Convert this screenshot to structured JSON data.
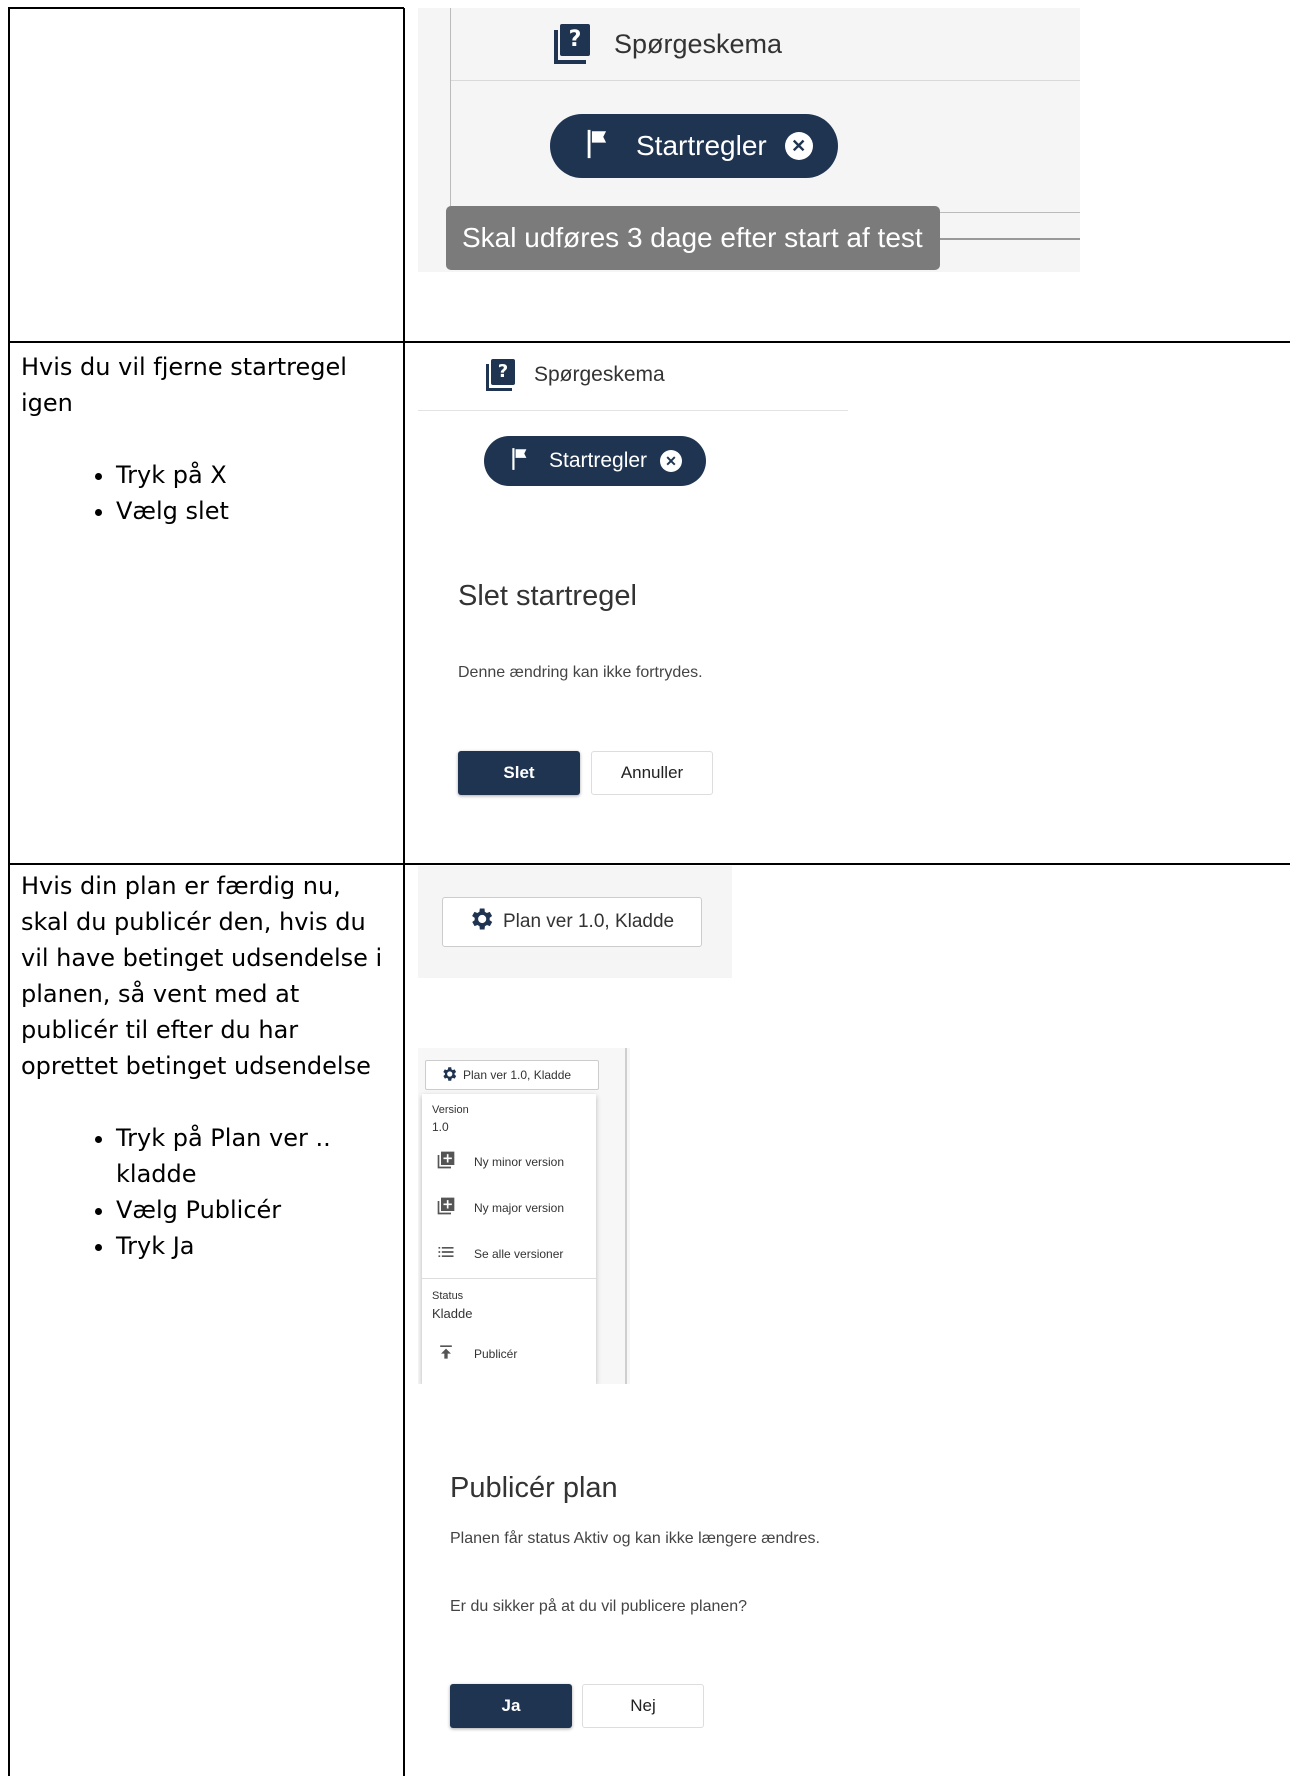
{
  "colors": {
    "navy": "#1f3451",
    "tooltip": "#7b7b7b"
  },
  "row1": {
    "left_text": "",
    "questionnaire_label": "Spørgeskema",
    "chip_label": "Startregler",
    "tooltip": "Skal udføres 3 dage efter start af test"
  },
  "row2": {
    "intro": "Hvis du vil fjerne startregel igen",
    "bullets": [
      "Tryk på X",
      "Vælg slet"
    ],
    "questionnaire_label": "Spørgeskema",
    "chip_label": "Startregler",
    "dialog_title": "Slet startregel",
    "dialog_text": "Denne ændring kan ikke fortrydes.",
    "confirm_label": "Slet",
    "cancel_label": "Annuller"
  },
  "row3": {
    "intro": "Hvis din plan er færdig nu, skal du publicér den, hvis du vil have betinget udsendelse i planen, så vent med at publicér til efter du har oprettet betinget udsendelse",
    "bullets": [
      "Tryk på Plan ver .. kladde",
      "Vælg Publicér",
      "Tryk Ja"
    ],
    "plan_button_label": "Plan ver 1.0, Kladde",
    "menu": {
      "button_label": "Plan ver 1.0, Kladde",
      "version_heading": "Version",
      "version_value": "1.0",
      "items": [
        "Ny minor version",
        "Ny major version",
        "Se alle versioner"
      ],
      "status_heading": "Status",
      "status_value": "Kladde",
      "publish_label": "Publicér"
    },
    "dialog_title": "Publicér plan",
    "dialog_text": "Planen får status Aktiv og kan ikke længere ændres.",
    "dialog_question": "Er du sikker på at du vil publicere planen?",
    "yes_label": "Ja",
    "no_label": "Nej"
  }
}
